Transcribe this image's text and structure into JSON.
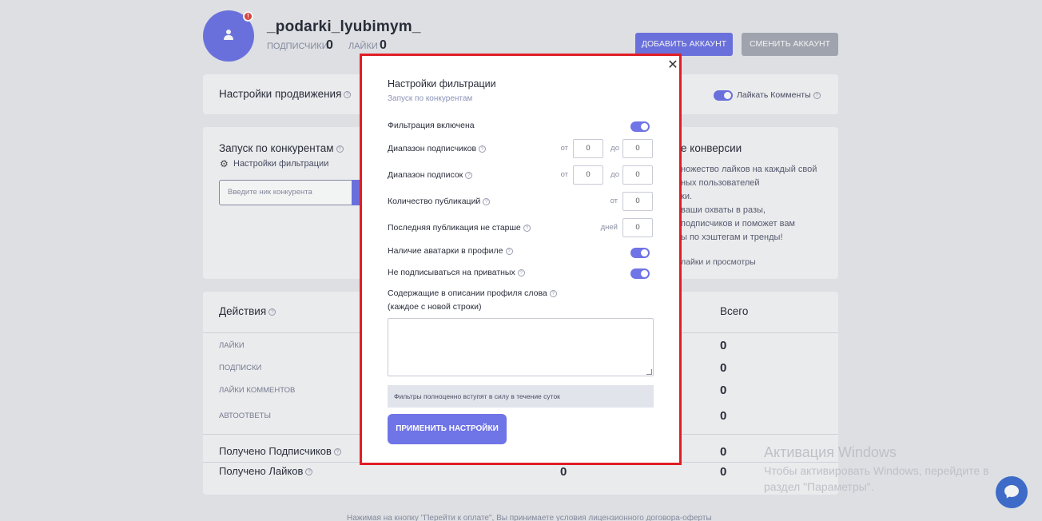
{
  "profile": {
    "username": "_podarki_lyubimym_",
    "badge": "!",
    "followers_label": "подписчики",
    "followers_value": "0",
    "likes_label": "лайки",
    "likes_value": "0"
  },
  "header_buttons": {
    "add_account": "ДОБАВИТЬ АККАУНТ",
    "switch_account": "СМЕНИТЬ АККАУНТ"
  },
  "promo_settings": {
    "title": "Настройки продвижения",
    "like_comments_label": "Лайкать Комменты"
  },
  "competitors": {
    "title": "Запуск по конкурентам",
    "filter_settings_link": "Настройки фильтрации",
    "input_placeholder": "Введите ник конкурента"
  },
  "conversion": {
    "title": "е конверсии",
    "lines": [
      "ножество лайков на каждый свой",
      "ных пользователей",
      "ки.",
      "ваши охваты в разы,",
      "подписчиков и поможет вам",
      "ы по хэштегам и тренды!"
    ],
    "footer_line": "лайки и просмотры"
  },
  "actions": {
    "title": "Действия",
    "total_header": "Всего",
    "rows": [
      {
        "label": "ЛАЙКИ",
        "total": "0"
      },
      {
        "label": "ПОДПИСКИ",
        "total": "0"
      },
      {
        "label": "ЛАЙКИ КОММЕНТОВ",
        "total": "0"
      },
      {
        "label": "АВТООТВЕТЫ",
        "total": "0"
      }
    ],
    "received_followers_label": "Получено Подписчиков",
    "received_followers_total": "0",
    "received_likes_label": "Получено Лайков",
    "received_likes_mid": "0",
    "received_likes_total": "0"
  },
  "windows_watermark": {
    "title": "Активация Windows",
    "line1": "Чтобы активировать Windows, перейдите в",
    "line2": "раздел \"Параметры\"."
  },
  "footer_note": "Нажимая на кнопку \"Перейти к оплате\", Вы принимаете условия лицензионного договора-оферты",
  "modal": {
    "close_glyph": "✕",
    "title": "Настройки фильтрации",
    "subtitle": "Запуск по конкурентам",
    "filter_enabled_label": "Фильтрация включена",
    "followers_range_label": "Диапазон подписчиков",
    "followers_from_prefix": "от",
    "followers_from": "0",
    "followers_to_prefix": "до",
    "followers_to": "0",
    "following_range_label": "Диапазон подписок",
    "following_from_prefix": "от",
    "following_from": "0",
    "following_to_prefix": "до",
    "following_to": "0",
    "posts_count_label": "Количество публикаций",
    "posts_from_prefix": "от",
    "posts_from": "0",
    "last_post_label": "Последняя публикация не старше",
    "last_post_prefix": "дней",
    "last_post_days": "0",
    "has_avatar_label": "Наличие аватарки в профиле",
    "skip_private_label": "Не подписываться на приватных",
    "bio_words_label": "Содержащие в описании профиля слова",
    "bio_words_hint": "(каждое с новой строки)",
    "bio_words_value": "",
    "note": "Фильтры полноценно вступят в силу в течение суток",
    "apply_button": "ПРИМЕНИТЬ НАСТРОЙКИ",
    "toggles": {
      "filter_enabled": true,
      "has_avatar": true,
      "skip_private": true
    }
  },
  "colors": {
    "accent": "#6f74e6",
    "modal_border": "#e01e25",
    "page_bg": "#e9eaee",
    "card_bg": "#f7f7f9"
  }
}
